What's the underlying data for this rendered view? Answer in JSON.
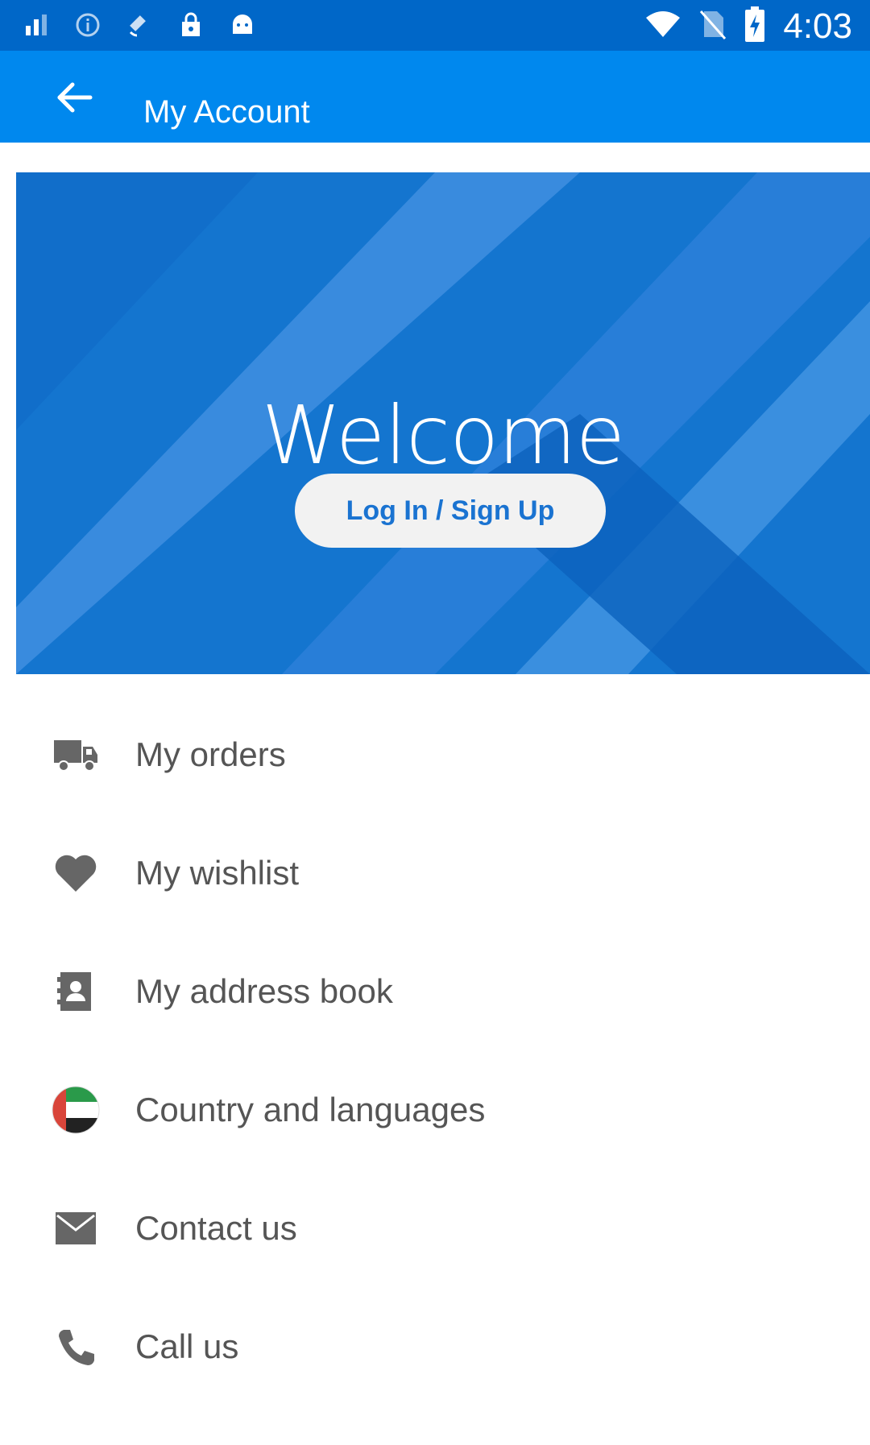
{
  "status_bar": {
    "time": "4:03",
    "icons": [
      "signal-icon",
      "info-icon",
      "satellite-icon",
      "lock-icon",
      "android-icon",
      "wifi-icon",
      "no-sim-icon",
      "battery-charging-icon"
    ]
  },
  "app_bar": {
    "title": "My Account",
    "back_icon": "back-arrow-icon"
  },
  "header": {
    "welcome": "Welcome",
    "login_button": "Log In / Sign Up"
  },
  "menu": {
    "items": [
      {
        "label": "My orders",
        "icon": "truck-icon"
      },
      {
        "label": "My wishlist",
        "icon": "heart-icon"
      },
      {
        "label": "My address book",
        "icon": "contact-card-icon"
      },
      {
        "label": "Country and languages",
        "icon": "uae-flag-icon"
      },
      {
        "label": "Contact us",
        "icon": "mail-icon"
      },
      {
        "label": "Call us",
        "icon": "phone-icon"
      }
    ]
  },
  "colors": {
    "status_bar": "#0067c8",
    "app_bar": "#0088ee",
    "header_bg": "#1475cf",
    "button_text": "#1a73d1",
    "menu_text": "#555555",
    "icon_gray": "#666666"
  }
}
